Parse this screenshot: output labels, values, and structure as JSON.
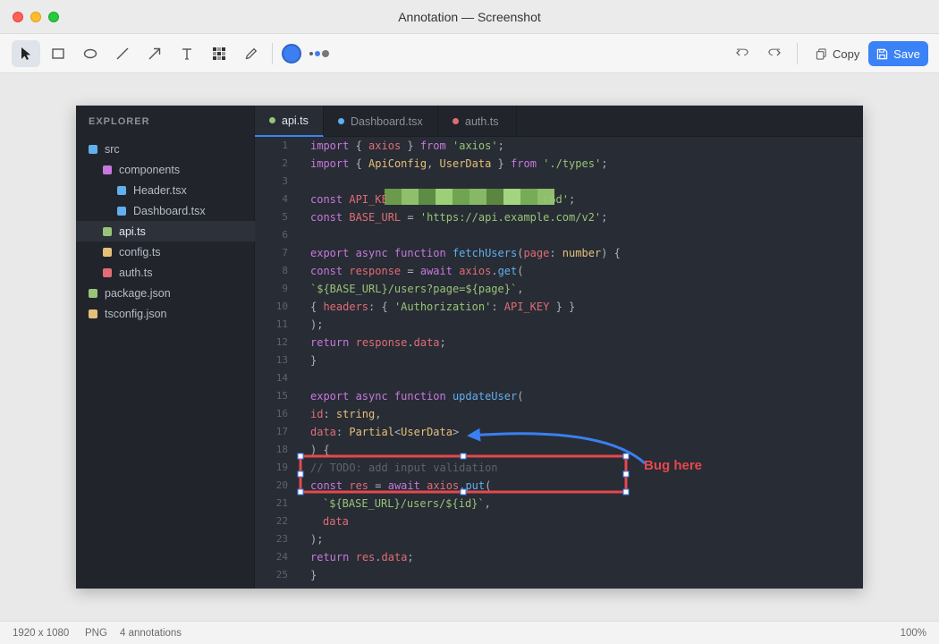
{
  "window": {
    "title": "Annotation — Screenshot"
  },
  "toolbar": {
    "tools": [
      {
        "name": "select-tool",
        "icon": "arrow-pointer-icon",
        "active": true
      },
      {
        "name": "rectangle-tool",
        "icon": "rectangle-icon"
      },
      {
        "name": "ellipse-tool",
        "icon": "ellipse-icon"
      },
      {
        "name": "line-tool",
        "icon": "line-icon"
      },
      {
        "name": "arrow-tool",
        "icon": "arrow-icon"
      },
      {
        "name": "text-tool",
        "icon": "text-icon"
      },
      {
        "name": "pixelate-tool",
        "icon": "pixelate-icon"
      },
      {
        "name": "pen-tool",
        "icon": "pen-icon"
      }
    ],
    "current_color": "#3b7ff0",
    "copy_label": "Copy",
    "save_label": "Save"
  },
  "screenshot": {
    "explorer": {
      "title": "EXPLORER",
      "items": [
        {
          "label": "src",
          "depth": 0,
          "color": "#61afef"
        },
        {
          "label": "components",
          "depth": 1,
          "color": "#c678dd"
        },
        {
          "label": "Header.tsx",
          "depth": 2,
          "color": "#61afef"
        },
        {
          "label": "Dashboard.tsx",
          "depth": 2,
          "color": "#61afef"
        },
        {
          "label": "api.ts",
          "depth": 1,
          "color": "#98c379",
          "selected": true
        },
        {
          "label": "config.ts",
          "depth": 1,
          "color": "#e5c07b"
        },
        {
          "label": "auth.ts",
          "depth": 1,
          "color": "#e06c75"
        },
        {
          "label": "package.json",
          "depth": 0,
          "color": "#98c379"
        },
        {
          "label": "tsconfig.json",
          "depth": 0,
          "color": "#e5c07b"
        }
      ]
    },
    "tabs": [
      {
        "label": "api.ts",
        "color": "#98c379",
        "active": true
      },
      {
        "label": "Dashboard.tsx",
        "color": "#61afef"
      },
      {
        "label": "auth.ts",
        "color": "#e06c75"
      }
    ],
    "code_lines": [
      {
        "n": "1",
        "tokens": [
          [
            "kw2",
            "import"
          ],
          [
            "pl",
            " { "
          ],
          [
            "kw",
            "axios"
          ],
          [
            "pl",
            " } "
          ],
          [
            "kw2",
            "from"
          ],
          [
            "pl",
            " "
          ],
          [
            "str",
            "'axios'"
          ],
          [
            "pl",
            ";"
          ]
        ]
      },
      {
        "n": "2",
        "tokens": [
          [
            "kw2",
            "import"
          ],
          [
            "pl",
            " { "
          ],
          [
            "ty",
            "ApiConfig"
          ],
          [
            "pl",
            ", "
          ],
          [
            "ty",
            "UserData"
          ],
          [
            "pl",
            " } "
          ],
          [
            "kw2",
            "from"
          ],
          [
            "pl",
            " "
          ],
          [
            "str",
            "'./types'"
          ],
          [
            "pl",
            ";"
          ]
        ]
      },
      {
        "n": "3",
        "tokens": []
      },
      {
        "n": "4",
        "tokens": [
          [
            "kw2",
            "const"
          ],
          [
            "pl",
            " "
          ],
          [
            "kw",
            "API_KE"
          ],
          [
            "pl",
            "                        "
          ],
          [
            "str",
            "c6d'"
          ],
          [
            "pl",
            ";"
          ]
        ]
      },
      {
        "n": "5",
        "tokens": [
          [
            "kw2",
            "const"
          ],
          [
            "pl",
            " "
          ],
          [
            "kw",
            "BASE_URL"
          ],
          [
            "pl",
            " = "
          ],
          [
            "str",
            "'https://api.example.com/v2'"
          ],
          [
            "pl",
            ";"
          ]
        ]
      },
      {
        "n": "6",
        "tokens": []
      },
      {
        "n": "7",
        "tokens": [
          [
            "kw2",
            "export async function"
          ],
          [
            "pl",
            " "
          ],
          [
            "fn",
            "fetchUsers"
          ],
          [
            "pl",
            "("
          ],
          [
            "kw",
            "page"
          ],
          [
            "pl",
            ": "
          ],
          [
            "ty",
            "number"
          ],
          [
            "pl",
            ") {"
          ]
        ]
      },
      {
        "n": "8",
        "tokens": [
          [
            "kw2",
            "const"
          ],
          [
            "pl",
            " "
          ],
          [
            "kw",
            "response"
          ],
          [
            "pl",
            " = "
          ],
          [
            "kw2",
            "await"
          ],
          [
            "pl",
            " "
          ],
          [
            "kw",
            "axios"
          ],
          [
            "pl",
            "."
          ],
          [
            "fn",
            "get"
          ],
          [
            "pl",
            "("
          ]
        ]
      },
      {
        "n": "9",
        "tokens": [
          [
            "str",
            "`${BASE_URL}/users?page=${page}`"
          ],
          [
            "pl",
            ","
          ]
        ]
      },
      {
        "n": "10",
        "tokens": [
          [
            "pl",
            "{ "
          ],
          [
            "kw",
            "headers"
          ],
          [
            "pl",
            ": { "
          ],
          [
            "str",
            "'Authorization'"
          ],
          [
            "pl",
            ": "
          ],
          [
            "kw",
            "API_KEY"
          ],
          [
            "pl",
            " } }"
          ]
        ]
      },
      {
        "n": "11",
        "tokens": [
          [
            "pl",
            ");"
          ]
        ]
      },
      {
        "n": "12",
        "tokens": [
          [
            "kw2",
            "return"
          ],
          [
            "pl",
            " "
          ],
          [
            "kw",
            "response"
          ],
          [
            "pl",
            "."
          ],
          [
            "kw",
            "data"
          ],
          [
            "pl",
            ";"
          ]
        ]
      },
      {
        "n": "13",
        "tokens": [
          [
            "pl",
            "}"
          ]
        ]
      },
      {
        "n": "14",
        "tokens": []
      },
      {
        "n": "15",
        "tokens": [
          [
            "kw2",
            "export async function"
          ],
          [
            "pl",
            " "
          ],
          [
            "fn",
            "updateUser"
          ],
          [
            "pl",
            "("
          ]
        ]
      },
      {
        "n": "16",
        "tokens": [
          [
            "kw",
            "id"
          ],
          [
            "pl",
            ": "
          ],
          [
            "ty",
            "string"
          ],
          [
            "pl",
            ","
          ]
        ]
      },
      {
        "n": "17",
        "tokens": [
          [
            "kw",
            "data"
          ],
          [
            "pl",
            ": "
          ],
          [
            "ty",
            "Partial"
          ],
          [
            "pl",
            "<"
          ],
          [
            "ty",
            "UserData"
          ],
          [
            "pl",
            ">"
          ]
        ]
      },
      {
        "n": "18",
        "tokens": [
          [
            "pl",
            ") {"
          ]
        ]
      },
      {
        "n": "19",
        "tokens": [
          [
            "cm",
            "// TODO: add input validation"
          ]
        ]
      },
      {
        "n": "20",
        "tokens": [
          [
            "kw2",
            "const"
          ],
          [
            "pl",
            " "
          ],
          [
            "kw",
            "res"
          ],
          [
            "pl",
            " = "
          ],
          [
            "kw2",
            "await"
          ],
          [
            "pl",
            " "
          ],
          [
            "kw",
            "axios"
          ],
          [
            "pl",
            "."
          ],
          [
            "fn",
            "put"
          ],
          [
            "pl",
            "("
          ]
        ]
      },
      {
        "n": "21",
        "tokens": [
          [
            "str",
            "`${BASE_URL}/users/${id}`"
          ],
          [
            "pl",
            ","
          ]
        ],
        "indent": true
      },
      {
        "n": "22",
        "tokens": [
          [
            "kw",
            "data"
          ]
        ],
        "indent": true
      },
      {
        "n": "23",
        "tokens": [
          [
            "pl",
            ");"
          ]
        ]
      },
      {
        "n": "24",
        "tokens": [
          [
            "kw2",
            "return"
          ],
          [
            "pl",
            " "
          ],
          [
            "kw",
            "res"
          ],
          [
            "pl",
            "."
          ],
          [
            "kw",
            "data"
          ],
          [
            "pl",
            ";"
          ]
        ]
      },
      {
        "n": "25",
        "tokens": [
          [
            "pl",
            "}"
          ]
        ]
      }
    ]
  },
  "annotations": {
    "label_text": "Bug here",
    "rect_color": "#e5484d",
    "arrow_color": "#3b7ff0",
    "pixelate_colors": [
      "#6a9a4a",
      "#8fbf6a",
      "#5d8c44",
      "#9ccf78",
      "#6fa550",
      "#87b865",
      "#5a8640",
      "#a3d47f",
      "#76ac57",
      "#8fbf6a"
    ]
  },
  "statusbar": {
    "dimensions": "1920 x 1080",
    "format": "PNG",
    "annotation_count": "4 annotations",
    "zoom": "100%"
  }
}
